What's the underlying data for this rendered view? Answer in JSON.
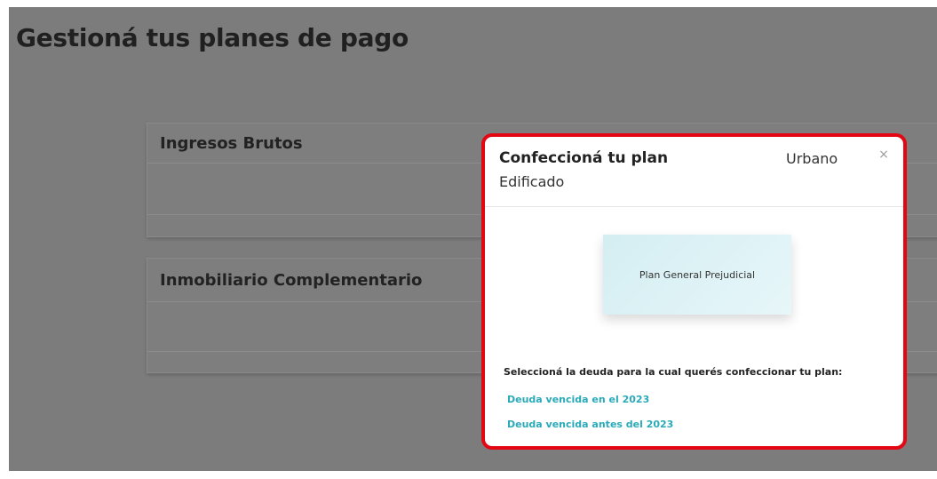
{
  "page": {
    "title": "Gestioná tus planes de pago"
  },
  "cards": [
    {
      "title": "Ingresos Brutos"
    },
    {
      "title": "Inmobiliario Complementario"
    }
  ],
  "modal": {
    "title": "Confeccioná tu plan",
    "subtitle_1": "Urbano",
    "subtitle_2": "Edificado",
    "close_symbol": "×",
    "plan_option": "Plan General Prejudicial",
    "select_label": "Seleccioná la deuda para la cual querés confeccionar tu plan:",
    "links": [
      "Deuda vencida en el 2023",
      "Deuda vencida antes del 2023"
    ]
  },
  "colors": {
    "overlay": "#7c7c7c",
    "highlight_border": "#e30613",
    "link": "#2aaab8",
    "plan_card": "#d4eef2"
  }
}
